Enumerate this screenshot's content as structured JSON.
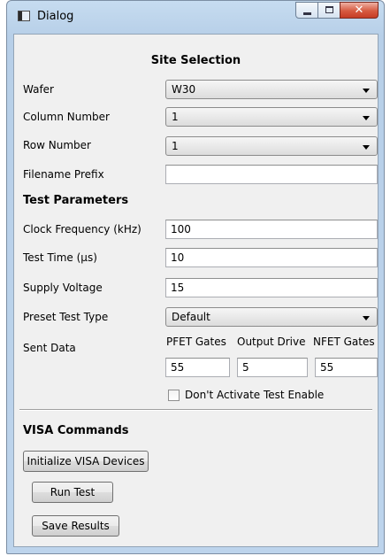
{
  "window": {
    "title": "Dialog",
    "icon": "app-window-icon"
  },
  "site_selection": {
    "heading": "Site Selection",
    "wafer": {
      "label": "Wafer",
      "value": "W30"
    },
    "column": {
      "label": "Column Number",
      "value": "1"
    },
    "row": {
      "label": "Row Number",
      "value": "1"
    },
    "filename_prefix": {
      "label": "Filename Prefix",
      "value": ""
    }
  },
  "test_parameters": {
    "heading": "Test Parameters",
    "clock": {
      "label": "Clock Frequency (kHz)",
      "value": "100"
    },
    "test_time": {
      "label": "Test Time (µs)",
      "value": "10"
    },
    "supply_voltage": {
      "label": "Supply Voltage",
      "value": "15"
    },
    "preset": {
      "label": "Preset Test Type",
      "value": "Default"
    },
    "sent_data": {
      "label": "Sent Data",
      "pfet_label": "PFET Gates",
      "pfet_value": "55",
      "output_label": "Output Drive",
      "output_value": "5",
      "nfet_label": "NFET Gates",
      "nfet_value": "55"
    },
    "dont_activate": {
      "label": "Don't Activate Test Enable",
      "checked": false
    }
  },
  "visa": {
    "heading": "VISA Commands",
    "init_button": "Initialize VISA Devices",
    "run_button": "Run Test",
    "save_button": "Save Results"
  }
}
